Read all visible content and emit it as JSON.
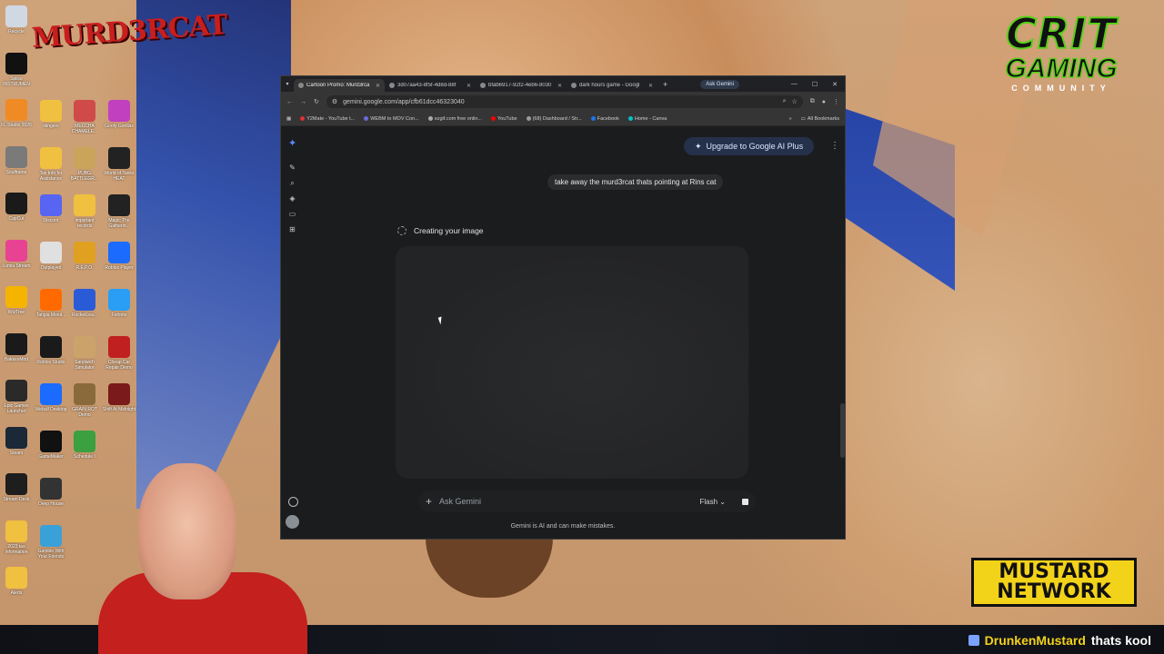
{
  "desktop": {
    "logo_text": "MURD3RCAT",
    "icons": [
      {
        "label": "Recycle",
        "color": "#cfd8e3"
      },
      {
        "label": "Splice INSTRUMEN",
        "color": "#111111"
      },
      {
        "label": "FL Studio 2026",
        "color": "#f08a24"
      },
      {
        "label": "Soulframe",
        "color": "#7a7a7a"
      },
      {
        "label": "CapCut",
        "color": "#1a1a1a"
      },
      {
        "label": "Lumia Stream",
        "color": "#e84393"
      },
      {
        "label": "WizTree",
        "color": "#f5b400"
      },
      {
        "label": "BakkesMod",
        "color": "#1a1a1a"
      },
      {
        "label": "Epic Games Launcher",
        "color": "#2a2a2a"
      },
      {
        "label": "Steam",
        "color": "#1b2838"
      },
      {
        "label": "Stream Deck",
        "color": "#1e1e1e"
      },
      {
        "label": "2023 tax information",
        "color": "#f0c040"
      },
      {
        "label": "Alerts",
        "color": "#f0c040"
      },
      {
        "label": "stingers",
        "color": "#f0c040"
      },
      {
        "label": "Tax Info for Assistance",
        "color": "#f0c040"
      },
      {
        "label": "Discord",
        "color": "#5865f2"
      },
      {
        "label": "Outplayed",
        "color": "#e0e0e0"
      },
      {
        "label": "Tangia Monit...",
        "color": "#ff6a00"
      },
      {
        "label": "Roblox Studio",
        "color": "#1a1a1a"
      },
      {
        "label": "Webull Desktop",
        "color": "#1b6bff"
      },
      {
        "label": "GameMaker",
        "color": "#111111"
      },
      {
        "label": "Deep House",
        "color": "#333333"
      },
      {
        "label": "Gamble With Your Friends",
        "color": "#3aa0d8"
      },
      {
        "label": "MECCHA CHAMELE...",
        "color": "#d04a4a"
      },
      {
        "label": "PUBG BATTLEGR...",
        "color": "#c9a45a"
      },
      {
        "label": "important records",
        "color": "#f0c040"
      },
      {
        "label": "R.E.P.O.",
        "color": "#e0a020"
      },
      {
        "label": "RocketLea...",
        "color": "#2a5bd7"
      },
      {
        "label": "Sandwich Simulator",
        "color": "#caa36b"
      },
      {
        "label": "GRAIN ROT Demo",
        "color": "#8a6a3a"
      },
      {
        "label": "Schedule I",
        "color": "#3aa040"
      },
      {
        "label": "Goofy Gorillas",
        "color": "#c040c0"
      },
      {
        "label": "World of Tanks HEAT",
        "color": "#222222"
      },
      {
        "label": "Magic The Gatherin...",
        "color": "#222222"
      },
      {
        "label": "Roblox Player",
        "color": "#1b6bff"
      },
      {
        "label": "Fortnite",
        "color": "#2a9df4"
      },
      {
        "label": "Cheap Car Repair Demo",
        "color": "#c02020"
      },
      {
        "label": "Shift At Midnight",
        "color": "#7a1a1a"
      }
    ]
  },
  "overlays": {
    "crit_line1": "CRIT",
    "crit_line2": "GAMING",
    "crit_line3": "COMMUNITY",
    "mustard_line1": "MUSTARD",
    "mustard_line2": "NETWORK",
    "chat_user": "DrunkenMustard",
    "chat_message": "thats kool"
  },
  "browser": {
    "tabs": [
      {
        "title": "Cartoon Promo: Murd3rca",
        "active": true
      },
      {
        "title": "3d07aa43-8f5f-4d8d-88f",
        "active": false
      },
      {
        "title": "bfab6917-92f2-4eb6-8030",
        "active": false
      },
      {
        "title": "dark hours game - Googl",
        "active": false
      }
    ],
    "new_tab": "+",
    "ask_gemini": "Ask Gemini",
    "url": "gemini.google.com/app/cfb61dcc46323040",
    "bookmarks": [
      {
        "label": "Y2Mate - YouTube t...",
        "color": "#d33"
      },
      {
        "label": "WEBM to MOV Con...",
        "color": "#6a6adf"
      },
      {
        "label": "ezgif.com free onlin...",
        "color": "#aaa"
      },
      {
        "label": "YouTube",
        "color": "#ff0000"
      },
      {
        "label": "(68) Dashboard / Str...",
        "color": "#9b9b9b"
      },
      {
        "label": "Facebook",
        "color": "#1877f2"
      },
      {
        "label": "Home - Canva",
        "color": "#00c4cc"
      }
    ],
    "all_bookmarks": "All Bookmarks"
  },
  "gemini": {
    "upgrade_label": "Upgrade to Google AI Plus",
    "user_message": "take away the murd3rcat thats pointing at Rins cat",
    "status": "Creating your image",
    "prompt_placeholder": "Ask Gemini",
    "model_label": "Flash",
    "disclaimer": "Gemini is AI and can make mistakes."
  }
}
